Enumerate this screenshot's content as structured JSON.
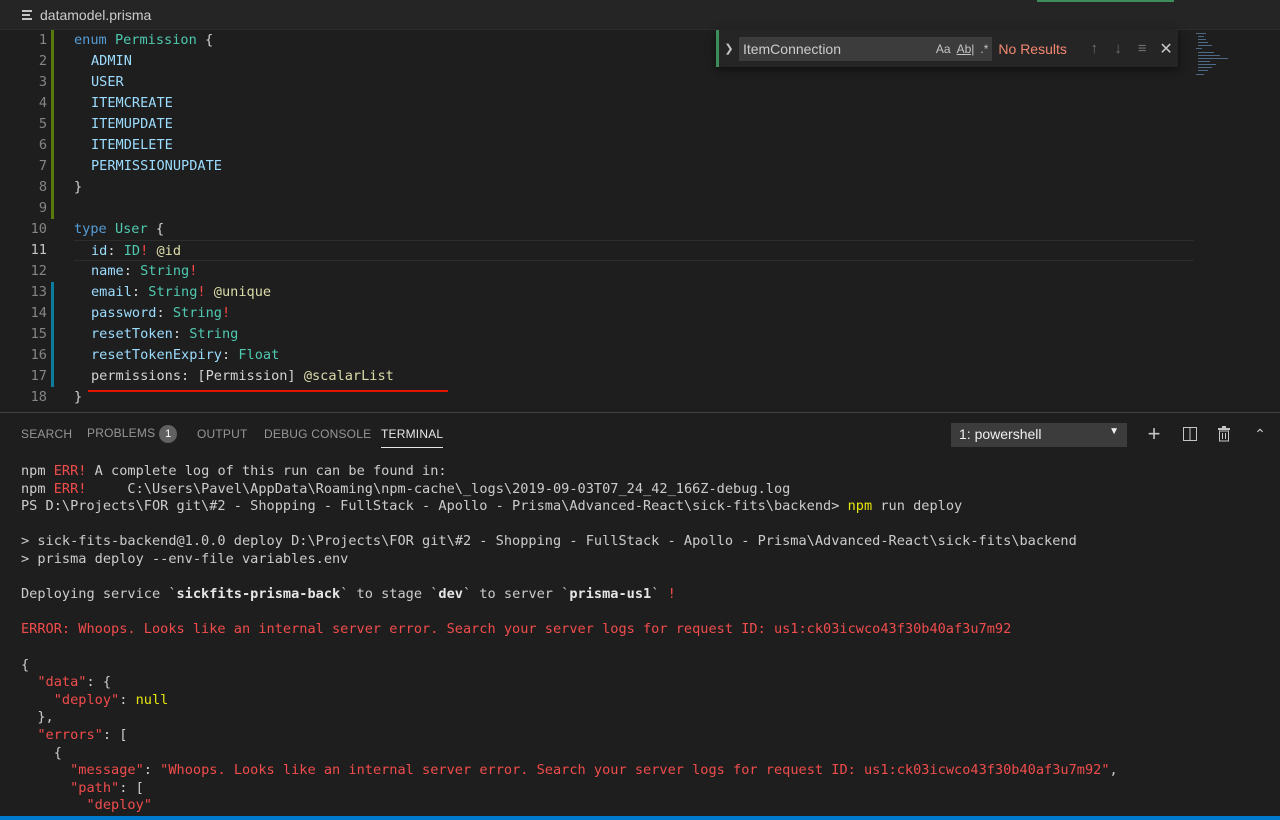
{
  "tab": {
    "filename": "datamodel.prisma"
  },
  "colors": {
    "accent_green": "#3c8d5a",
    "error_red": "#f14c4c",
    "squiggle": "#e51400"
  },
  "editor": {
    "line_numbers": [
      "1",
      "2",
      "3",
      "4",
      "5",
      "6",
      "7",
      "8",
      "9",
      "10",
      "11",
      "12",
      "13",
      "14",
      "15",
      "16",
      "17",
      "18"
    ],
    "active_line": "11",
    "lines": {
      "l1_kw": "enum",
      "l1_name": "Permission",
      "l1_brace": " {",
      "l2": "ADMIN",
      "l3": "USER",
      "l4": "ITEMCREATE",
      "l5": "ITEMUPDATE",
      "l6": "ITEMDELETE",
      "l7": "PERMISSIONUPDATE",
      "l8": "}",
      "l10_kw": "type",
      "l10_name": "User",
      "l10_brace": " {",
      "l11_f": "id",
      "l11_t": "ID",
      "l11_b": "!",
      "l11_d": "@id",
      "l12_f": "name",
      "l12_t": "String",
      "l12_b": "!",
      "l13_f": "email",
      "l13_t": "String",
      "l13_b": "!",
      "l13_d": "@unique",
      "l14_f": "password",
      "l14_t": "String",
      "l14_b": "!",
      "l15_f": "resetToken",
      "l15_t": "String",
      "l16_f": "resetTokenExpiry",
      "l16_t": "Float",
      "l17_f": "permissions",
      "l17_t": "[Permission]",
      "l17_d": "@scalarList",
      "l18": "}",
      "colon": ":"
    }
  },
  "find_widget": {
    "query": "ItemConnection",
    "match_case": "Aa",
    "whole_word": "Ab|",
    "regex": ".*",
    "result": "No Results",
    "prev_icon": "arrow-up-icon",
    "next_icon": "arrow-down-icon",
    "selection_icon": "find-in-selection-icon",
    "close_icon": "close-icon"
  },
  "panel": {
    "tabs": [
      "SEARCH",
      "PROBLEMS",
      "OUTPUT",
      "DEBUG CONSOLE",
      "TERMINAL"
    ],
    "problems_count": "1",
    "terminal_selector": "1: powershell"
  },
  "terminal": {
    "l1_a": "npm ",
    "l1_err": "ERR!",
    "l1_b": " A complete log of this run can be found in:",
    "l2_a": "npm ",
    "l2_err": "ERR!",
    "l2_b": "     C:\\Users\\Pavel\\AppData\\Roaming\\npm-cache\\_logs\\2019-09-03T07_24_42_166Z-debug.log",
    "l3_prompt": "PS D:\\Projects\\FOR git\\#2 - Shopping - FullStack - Apollo - Prisma\\Advanced-React\\sick-fits\\backend> ",
    "l3_npm": "npm",
    "l3_rest": " run deploy",
    "l5": "> sick-fits-backend@1.0.0 deploy D:\\Projects\\FOR git\\#2 - Shopping - FullStack - Apollo - Prisma\\Advanced-React\\sick-fits\\backend",
    "l6": "> prisma deploy --env-file variables.env",
    "l8_a": "Deploying service `",
    "l8_service": "sickfits-prisma-back",
    "l8_b": "` to stage `",
    "l8_stage": "dev",
    "l8_c": "` to server `",
    "l8_server": "prisma-us1",
    "l8_d": "` ",
    "l8_bang": "!",
    "l10": "ERROR: Whoops. Looks like an internal server error. Search your server logs for request ID: us1:ck03icwco43f30b40af3u7m92",
    "l12": "{",
    "l13_k": "\"data\"",
    "l13_r": ": {",
    "l14_k": "\"deploy\"",
    "l14_c": ": ",
    "l14_v": "null",
    "l15": "  },",
    "l16_k": "\"errors\"",
    "l16_r": ": [",
    "l17": "    {",
    "l18_k": "\"message\"",
    "l18_c": ": ",
    "l18_v": "\"Whoops. Looks like an internal server error. Search your server logs for request ID: us1:ck03icwco43f30b40af3u7m92\"",
    "l18_e": ",",
    "l19_k": "\"path\"",
    "l19_r": ": [",
    "l20_v": "\"deploy\""
  }
}
